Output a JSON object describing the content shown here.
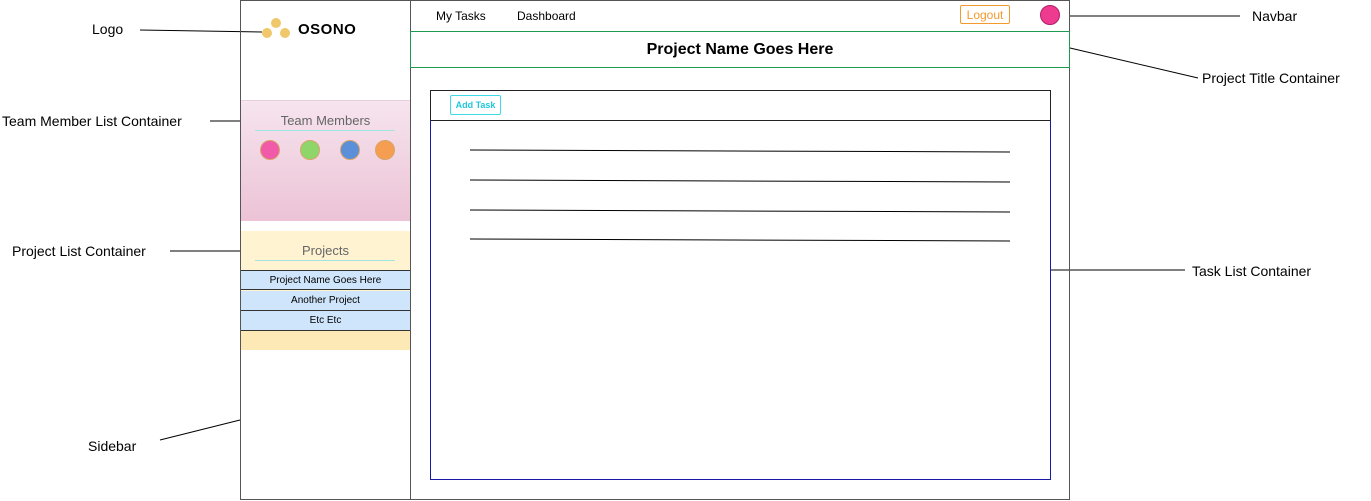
{
  "callouts": {
    "logo": "Logo",
    "team_member_list_container": "Team Member List Container",
    "project_list_container": "Project List Container",
    "sidebar": "Sidebar",
    "navbar": "Navbar",
    "project_title_container": "Project Title Container",
    "task_list_container": "Task List Container"
  },
  "brand": {
    "name": "OSONO"
  },
  "sidebar": {
    "team_title": "Team Members",
    "team_member_colors": [
      "#f05aa8",
      "#8ed66a",
      "#5b8fd8",
      "#f59e52"
    ],
    "projects_title": "Projects",
    "projects": [
      "Project Name Goes Here",
      "Another Project",
      "Etc Etc"
    ]
  },
  "navbar": {
    "links": [
      "My Tasks",
      "Dashboard"
    ],
    "logout_label": "Logout",
    "avatar_color": "#ee3a8f"
  },
  "main": {
    "project_title": "Project Name Goes Here",
    "add_task_label": "Add Task",
    "task_placeholder_lines": 4
  }
}
